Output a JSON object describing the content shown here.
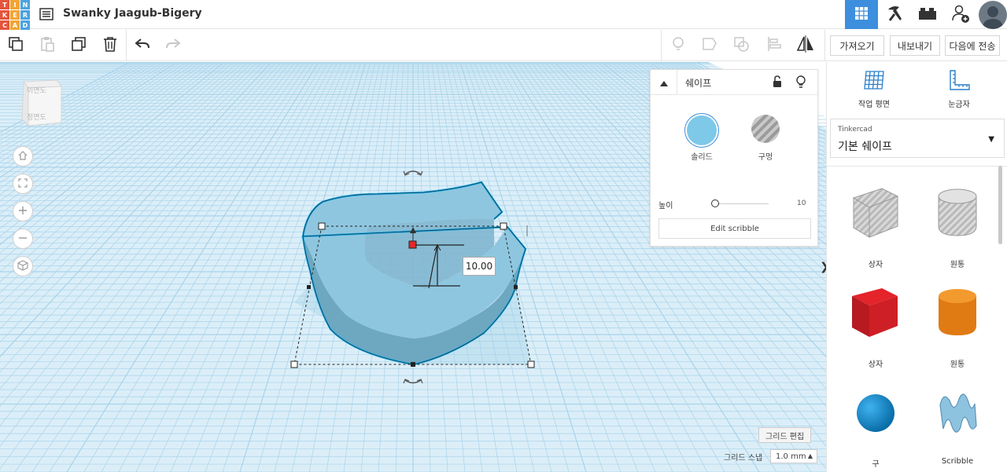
{
  "app": {
    "logo_letters": [
      "T",
      "I",
      "N",
      "K",
      "E",
      "R",
      "C",
      "A",
      "D"
    ],
    "logo_colors": [
      "#e4543d",
      "#f3a533",
      "#4aa3df",
      "#e4543d",
      "#f3a533",
      "#4aa3df",
      "#e4543d",
      "#f3a533",
      "#4aa3df"
    ],
    "project_title": "Swanky Jaagub-Bigery"
  },
  "header": {
    "nav_icons": [
      "grid-view-icon",
      "pickaxe-icon",
      "bricks-icon",
      "add-user-icon",
      "avatar"
    ],
    "active_color": "#3d8fde"
  },
  "toolbar": {
    "import_label": "가져오기",
    "export_label": "내보내기",
    "send_to_label": "다음에 전송"
  },
  "viewport": {
    "navcube_top": "이면도",
    "navcube_front": "정면도",
    "dimension_value": "10.00",
    "grid_edit_label": "그리드 편집",
    "snap_label": "그리드 스냅",
    "snap_value": "1.0 mm",
    "shape_color": "#7ec0da",
    "grid_color": "#bfe0f0"
  },
  "inspector": {
    "title": "쉐이프",
    "solid_label": "솔리드",
    "hole_label": "구멍",
    "height_label": "높이",
    "height_value": "10",
    "edit_scribble_label": "Edit scribble",
    "solid_color": "#7ec8e8"
  },
  "rightpanel": {
    "workplane_label": "작업 평면",
    "ruler_label": "눈금자",
    "library_source": "Tinkercad",
    "library_name": "기본 쉐이프",
    "shapes": [
      {
        "label": "상자",
        "icon": "box-hole-icon"
      },
      {
        "label": "원통",
        "icon": "cylinder-hole-icon"
      },
      {
        "label": "상자",
        "icon": "box-icon"
      },
      {
        "label": "원통",
        "icon": "cylinder-icon"
      },
      {
        "label": "구",
        "icon": "sphere-icon"
      },
      {
        "label": "Scribble",
        "icon": "scribble-icon"
      }
    ]
  }
}
